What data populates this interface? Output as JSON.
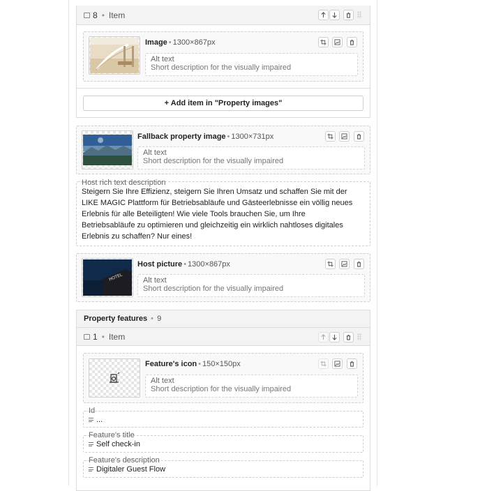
{
  "item8": {
    "index": "8",
    "type_label": "Item"
  },
  "item8_image": {
    "title": "Image",
    "size": "1300×867px",
    "alt_label": "Alt text",
    "alt_placeholder": "Short description for the visually impaired"
  },
  "add_item_label": "+ Add item in \"Property images\"",
  "fallback_image": {
    "title": "Fallback property image",
    "size": "1300×731px",
    "alt_label": "Alt text",
    "alt_placeholder": "Short description for the visually impaired"
  },
  "host_rich_text": {
    "label": "Host rich text description",
    "lines": [
      "Steigern Sie Ihre Effizienz, steigern Sie Ihren Umsatz und schaffen Sie mit der",
      "LIKE MAGIC Plattform für Betriebsabläufe und Gästeerlebnisse ein völlig neues",
      "Erlebnis für alle Beteiligten! Wie viele Tools brauchen Sie, um Ihre",
      "Betriebsabläufe zu optimieren und gleichzeitig ein wirklich nahtloses digitales",
      "Erlebnis zu schaffen? Nur eines!"
    ]
  },
  "host_picture": {
    "title": "Host picture",
    "size": "1300×867px",
    "alt_label": "Alt text",
    "alt_placeholder": "Short description for the visually impaired"
  },
  "property_features": {
    "title": "Property features",
    "count": "9"
  },
  "feature_item": {
    "index": "1",
    "type_label": "Item"
  },
  "feature_icon": {
    "title": "Feature's icon",
    "size": "150×150px",
    "alt_label": "Alt text",
    "alt_placeholder": "Short description for the visually impaired"
  },
  "fields": {
    "id_label": "Id",
    "id_value": "...",
    "title_label": "Feature's title",
    "title_value": "Self check-in",
    "desc_label": "Feature's description",
    "desc_value": "Digitaler Guest Flow"
  },
  "icons": [
    "comment-icon",
    "arrow-up-icon",
    "arrow-down-icon",
    "trash-icon",
    "drag-handle-icon",
    "crop-icon",
    "replace-image-icon"
  ]
}
